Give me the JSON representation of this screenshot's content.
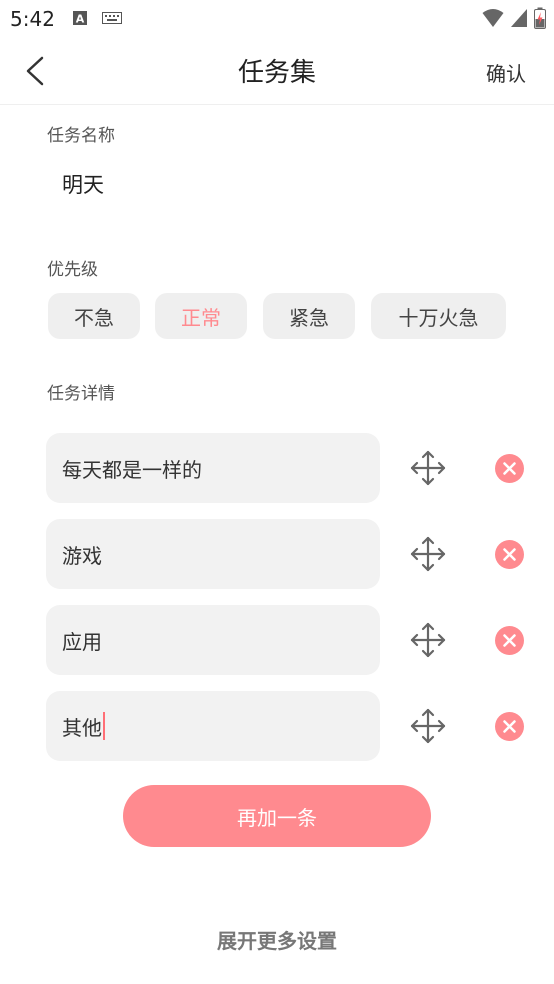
{
  "status_bar": {
    "time": "5:42",
    "left_icons": [
      "a-notification-icon",
      "keyboard-icon"
    ],
    "right_icons": [
      "wifi-icon",
      "signal-icon",
      "battery-charging-icon"
    ]
  },
  "header": {
    "back_icon": "chevron-left-icon",
    "title": "任务集",
    "confirm_label": "确认"
  },
  "task_name": {
    "label": "任务名称",
    "value": "明天"
  },
  "priority": {
    "label": "优先级",
    "options": [
      "不急",
      "正常",
      "紧急",
      "十万火急"
    ],
    "selected": "正常",
    "active_color": "#ff8a8f"
  },
  "details": {
    "label": "任务详情",
    "items": [
      {
        "text": "每天都是一样的"
      },
      {
        "text": "游戏"
      },
      {
        "text": "应用"
      },
      {
        "text": "其他"
      }
    ],
    "move_icon": "move-arrows-icon",
    "delete_icon": "close-circle-icon"
  },
  "add_button_label": "再加一条",
  "expand_label": "展开更多设置",
  "colors": {
    "accent": "#ff8a8f",
    "chip_bg": "#efefef",
    "input_bg": "#f2f2f2"
  }
}
